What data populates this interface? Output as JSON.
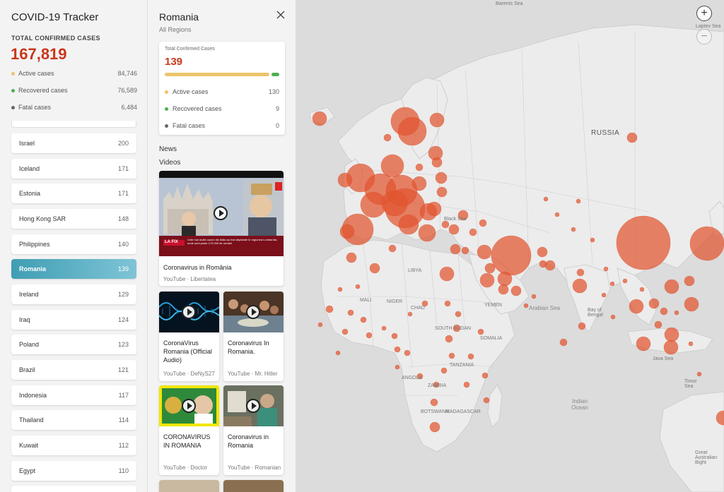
{
  "app": {
    "title": "COVID-19 Tracker",
    "total_label": "TOTAL CONFIRMED CASES",
    "total_value": "167,819",
    "stats": [
      {
        "label": "Active cases",
        "value": "84,746",
        "color": "#ecc46b"
      },
      {
        "label": "Recovered cases",
        "value": "76,589",
        "color": "#4caf50"
      },
      {
        "label": "Fatal cases",
        "value": "6,484",
        "color": "#666666"
      }
    ]
  },
  "countries": [
    {
      "name": "Israel",
      "count": "200"
    },
    {
      "name": "Iceland",
      "count": "171"
    },
    {
      "name": "Estonia",
      "count": "171"
    },
    {
      "name": "Hong Kong SAR",
      "count": "148"
    },
    {
      "name": "Philippines",
      "count": "140"
    },
    {
      "name": "Romania",
      "count": "139",
      "selected": true
    },
    {
      "name": "Ireland",
      "count": "129"
    },
    {
      "name": "Iraq",
      "count": "124"
    },
    {
      "name": "Poland",
      "count": "123"
    },
    {
      "name": "Brazil",
      "count": "121"
    },
    {
      "name": "Indonesia",
      "count": "117"
    },
    {
      "name": "Thailand",
      "count": "114"
    },
    {
      "name": "Kuwait",
      "count": "112"
    },
    {
      "name": "Egypt",
      "count": "110"
    }
  ],
  "detail": {
    "region_name": "Romania",
    "subtitle": "All Regions",
    "card_label": "Total Confirmed Cases",
    "card_value": "139",
    "active_fraction": 0.935,
    "recovered_fraction": 0.065,
    "stats": [
      {
        "label": "Active cases",
        "value": "130",
        "color": "#ecc46b"
      },
      {
        "label": "Recovered cases",
        "value": "9",
        "color": "#4caf50"
      },
      {
        "label": "Fatal cases",
        "value": "0",
        "color": "#666666"
      }
    ],
    "news_heading": "News",
    "videos_heading": "Videos",
    "featured_video": {
      "title": "Coronavirus in România",
      "source": "YouTube · Libertatea",
      "overlay_badge": "LA FIX",
      "overlay_caption": "Cele mai multe cazuri din Italia au fost depistate în regiunea Lombardia, unde sunt peste 170.000 de români"
    },
    "videos": [
      {
        "title": "CoronaVirus Romania (Official Audio)",
        "source": "YouTube · DeNyS27"
      },
      {
        "title": "Coronavirus In Romania.",
        "source": "YouTube · Mr. Hitler"
      },
      {
        "title": "CORONAVIRUS IN ROMANIA",
        "source": "YouTube · Doctor"
      },
      {
        "title": "Coronavirus in Romania",
        "source": "YouTube · Romanian"
      }
    ]
  },
  "map": {
    "zoom_in": "+",
    "zoom_out": "−",
    "bubble_color": "#e2552f",
    "labels": {
      "barents_sea": "Barents Sea",
      "laptev_sea": "Laptev Sea",
      "russia": "RUSSIA",
      "black_sea": "Black Sea",
      "libya": "LIBYA",
      "mali": "MALI",
      "niger": "NIGER",
      "chad": "CHAD",
      "south_sudan": "SOUTH SUDAN",
      "somalia": "SOMALIA",
      "tanzania": "TANZANIA",
      "angola": "ANGOLA",
      "zambia": "ZAMBIA",
      "botswana": "BOTSWANA",
      "madagascar": "MADAGASCAR",
      "yemen": "YEMEN",
      "arabian_sea": "Arabian Sea",
      "bay_of_bengal": "Bay of Bengal",
      "java_sea": "Java Sea",
      "timor_sea": "Timor Sea",
      "indian_ocean": "Indian Ocean",
      "great_australian_bight": "Great Australian Bight"
    }
  }
}
